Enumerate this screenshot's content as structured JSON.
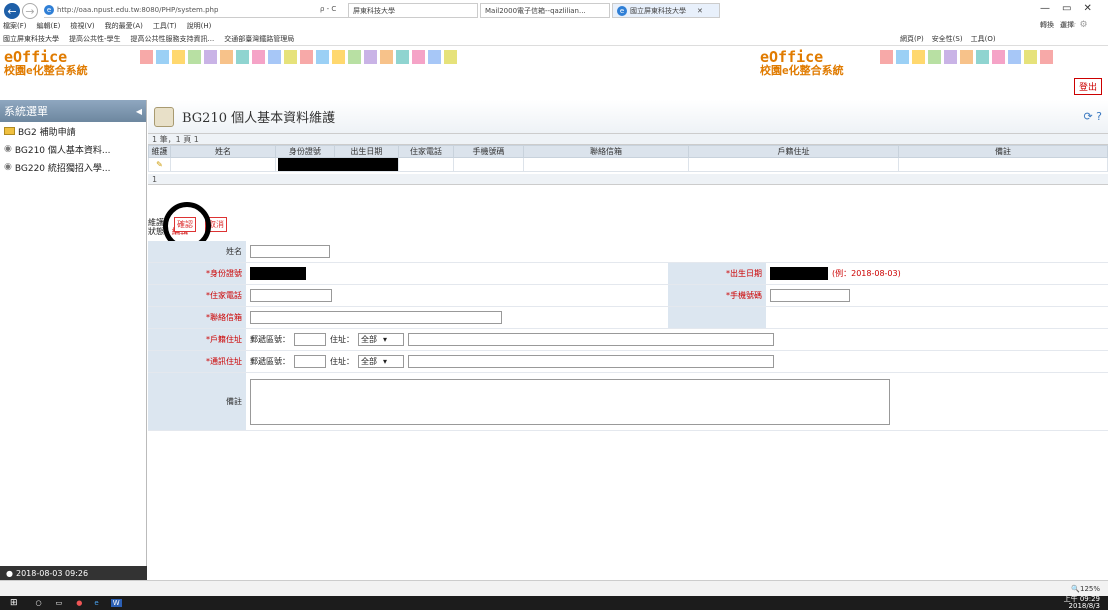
{
  "browser": {
    "url": "http://oaa.npust.edu.tw:8080/PHP/system.php",
    "search_hint": "ρ - C",
    "tabs": [
      "屏東科技大學",
      "Mail2000電子信箱--qazlilian...",
      "國立屏東科技大學"
    ],
    "menus": [
      "檔案(F)",
      "編輯(E)",
      "檢視(V)",
      "我的最愛(A)",
      "工具(T)",
      "說明(H)"
    ],
    "favorites": [
      "國立屏東科技大學",
      "提高公共性-學生",
      "提高公共性服務支持資訊...",
      "交通部臺灣鐵路管理局"
    ],
    "right_tools": [
      "網頁(P)",
      "安全性(S)",
      "工具(O)"
    ],
    "translate": "轉換",
    "select": "選擇",
    "window_controls": [
      "—",
      "▭",
      "✕"
    ],
    "zoom": "125%"
  },
  "header": {
    "logo_en": "eOffice",
    "logo_zh": "校園e化整合系統",
    "logout": "登出",
    "strip_colors": [
      "#f7a9a8",
      "#9bd0f5",
      "#ffd86e",
      "#b8e0a3",
      "#c9b3e6",
      "#f7c28a",
      "#8fd4d0",
      "#f5a3c7",
      "#a7c7f7",
      "#e6e27a",
      "#f7a9a8",
      "#9bd0f5",
      "#ffd86e",
      "#b8e0a3",
      "#c9b3e6",
      "#f7c28a",
      "#8fd4d0",
      "#f5a3c7",
      "#a7c7f7",
      "#e6e27a"
    ]
  },
  "sidebar": {
    "title": "系統選單",
    "folder": "BG2 補助申請",
    "items": [
      "BG210 個人基本資料...",
      "BG220 統招獨招入學..."
    ],
    "clock": "2018-08-03 09:26"
  },
  "page": {
    "title": "BG210 個人基本資料維護",
    "pager": "1 筆，1 頁  1",
    "pager2": "1",
    "columns": [
      "維護",
      "姓名",
      "身份證號",
      "出生日期",
      "住家電話",
      "手機號碼",
      "聯絡信箱",
      "戶籍住址",
      "備註"
    ]
  },
  "form": {
    "mode_label": "維護：",
    "status_label": "狀態：",
    "status_value": "編輯",
    "confirm_button": "確認",
    "cancel_button": "取消",
    "name_label": "姓名",
    "id_label": "*身份證號",
    "birth_label": "*出生日期",
    "birth_example": "(例：2018-08-03)",
    "home_phone_label": "*住家電話",
    "mobile_label": "*手機號碼",
    "email_label": "*聯絡信箱",
    "reg_addr_label": "*戶籍住址",
    "mail_addr_label": "*通訊住址",
    "postcode_label": "郵遞區號：",
    "addr_label": "住址：",
    "addr_select": "全部",
    "note_label": "備註"
  },
  "taskbar": {
    "time": "上午 09:29",
    "date": "2018/8/3"
  }
}
